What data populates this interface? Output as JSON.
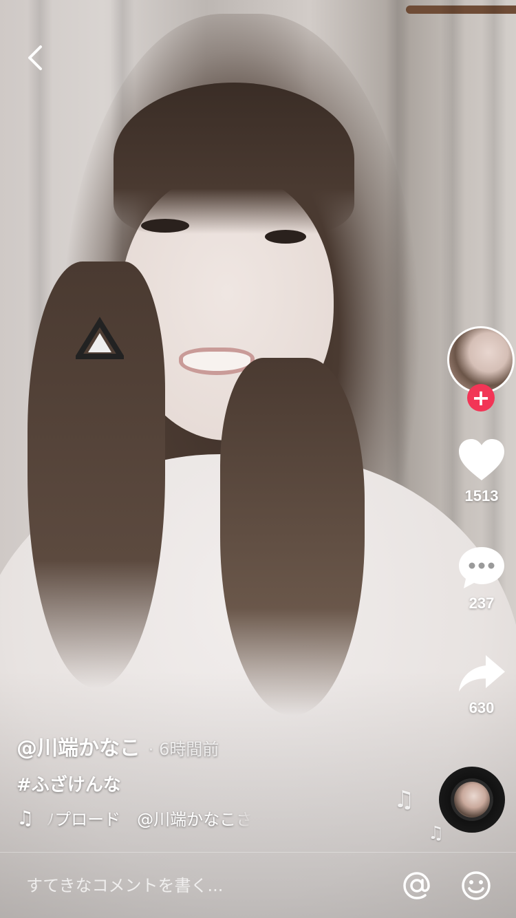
{
  "video": {
    "author": "@川端かなこ",
    "separator": "·",
    "posted": "6時間前",
    "caption": "#ふざけんな",
    "music_icon": "music-note-icon",
    "music_text": "ﾉプロード　@川端かなこさ"
  },
  "actions": {
    "follow_label": "+",
    "likes": "1513",
    "comments": "237",
    "shares": "630"
  },
  "comment": {
    "placeholder": "すてきなコメントを書く..."
  },
  "icons": {
    "back": "chevron-left-icon",
    "like": "heart-icon",
    "comment": "speech-bubble-icon",
    "share": "share-arrow-icon",
    "mention": "at-sign-icon",
    "emoji": "smiley-icon",
    "disc": "music-disc-icon"
  },
  "colors": {
    "follow_badge": "#f23556",
    "text": "#ffffff"
  }
}
